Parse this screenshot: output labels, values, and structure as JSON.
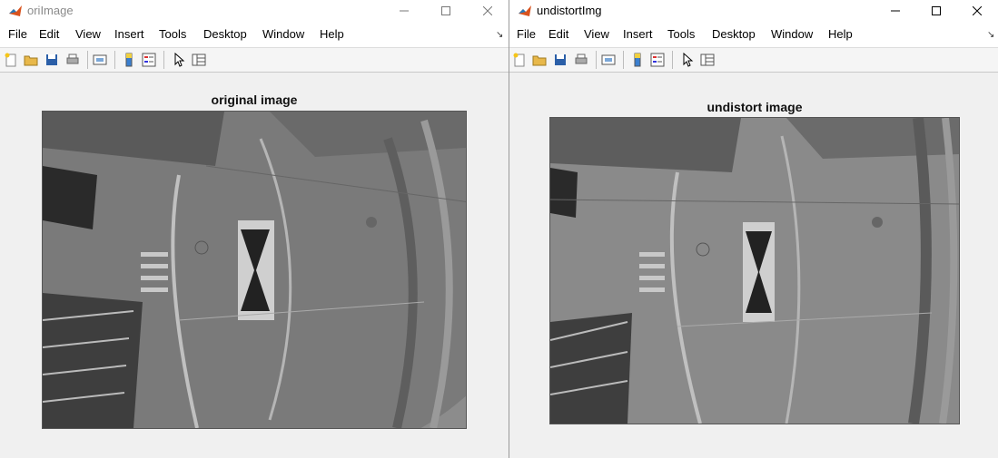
{
  "windows": [
    {
      "title": "oriImage",
      "axes_title": "original image",
      "image_description_icon": "grayscale-fisheye-street-image"
    },
    {
      "title": "undistortImg",
      "axes_title": "undistort image",
      "image_description_icon": "grayscale-undistorted-street-image"
    }
  ],
  "menu": [
    "File",
    "Edit",
    "View",
    "Insert",
    "Tools",
    "Desktop",
    "Window",
    "Help"
  ],
  "toolbar_icons": [
    "new-figure-icon",
    "open-file-icon",
    "save-icon",
    "print-icon",
    "link-plot-icon",
    "colorbar-icon",
    "legend-icon",
    "pointer-icon",
    "property-inspector-icon"
  ],
  "colors": {
    "window_bg": "#f0f0f0",
    "title_inactive": "#8a8a8a",
    "image_gray": "#8c8c8c"
  }
}
